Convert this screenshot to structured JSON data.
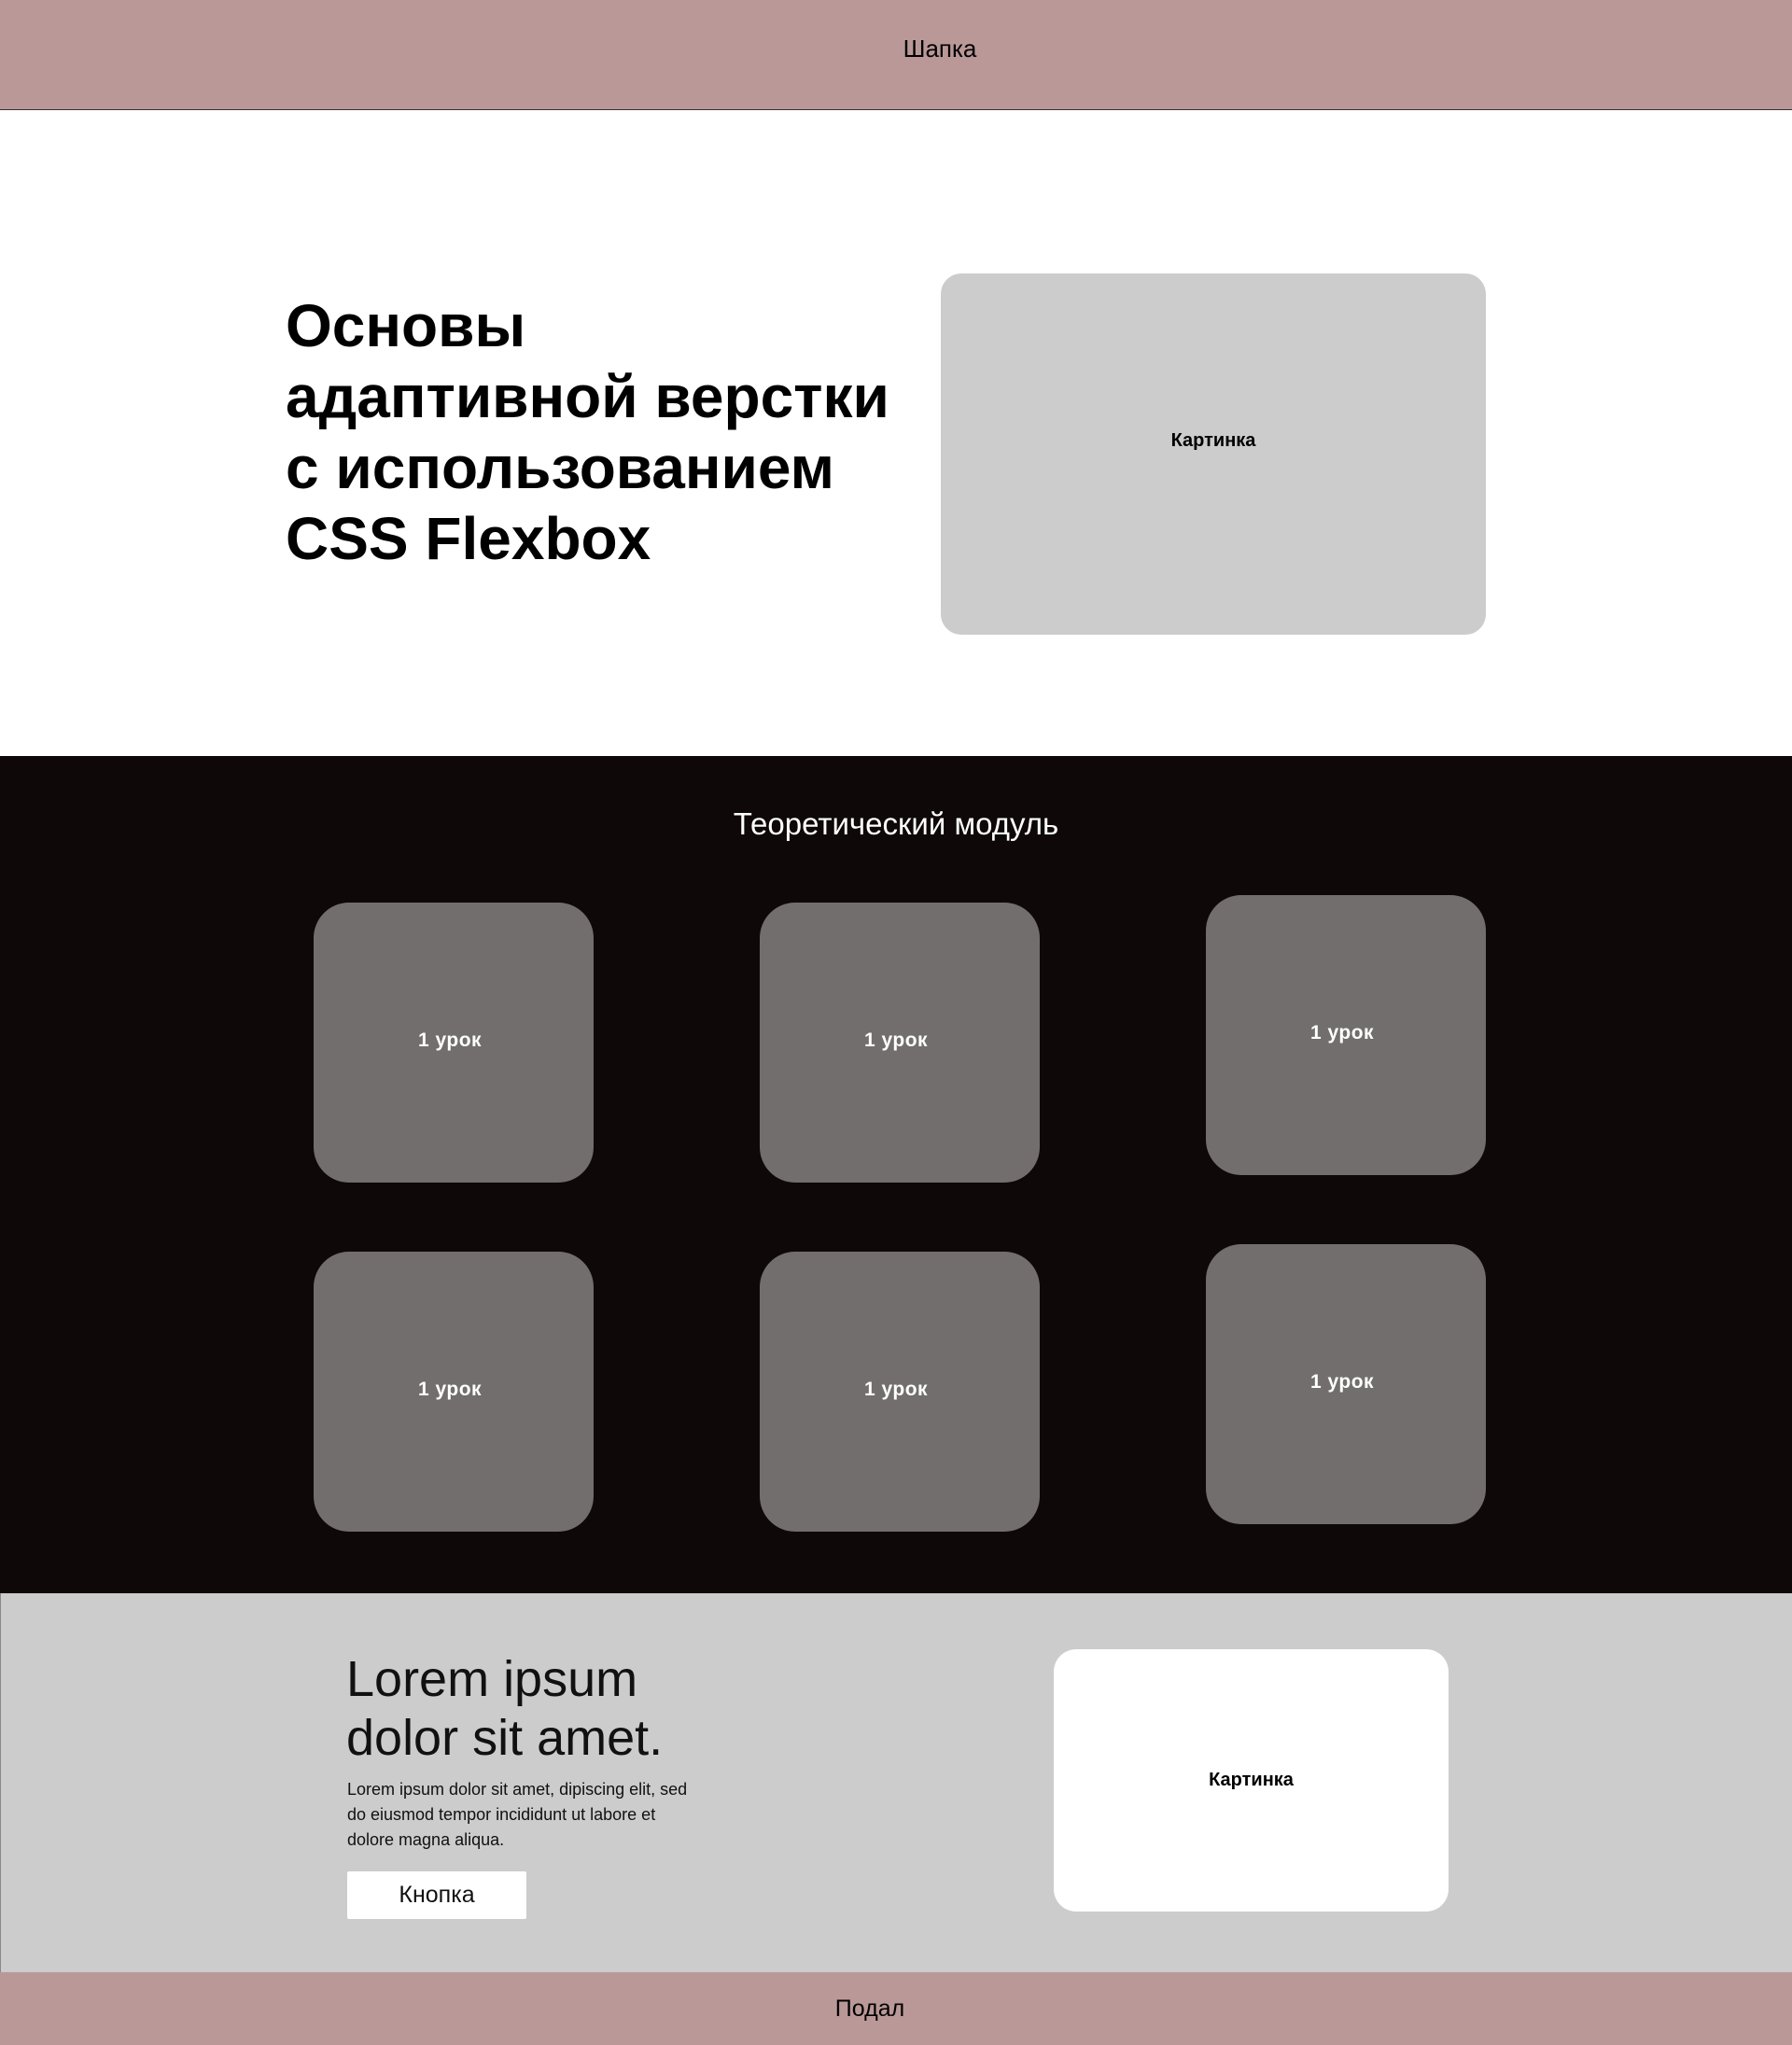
{
  "header": {
    "title": "Шапка"
  },
  "hero": {
    "title_lines": [
      "Основы",
      "адаптивной верстки",
      "с использованием",
      "CSS Flexbox"
    ],
    "image_label": "Картинка"
  },
  "module": {
    "title": "Теоретический модуль",
    "lessons": [
      {
        "label": "1 урок"
      },
      {
        "label": "1 урок"
      },
      {
        "label": "1 урок"
      },
      {
        "label": "1 урок"
      },
      {
        "label": "1 урок"
      },
      {
        "label": "1 урок"
      }
    ]
  },
  "promo": {
    "title_lines": [
      "Lorem ipsum",
      "dolor sit amet."
    ],
    "text_lines": [
      "Lorem ipsum dolor sit amet, dipiscing elit, sed",
      "do eiusmod tempor incididunt ut labore et",
      "dolore magna aliqua."
    ],
    "button_label": "Кнопка",
    "image_label": "Картинка"
  },
  "footer": {
    "title": "Подал"
  },
  "colors": {
    "header_bg": "#bb9898",
    "module_bg": "#0e0808",
    "card_bg": "#726e6d",
    "placeholder_bg": "#cccccc",
    "footer_bg": "#bb9898"
  }
}
